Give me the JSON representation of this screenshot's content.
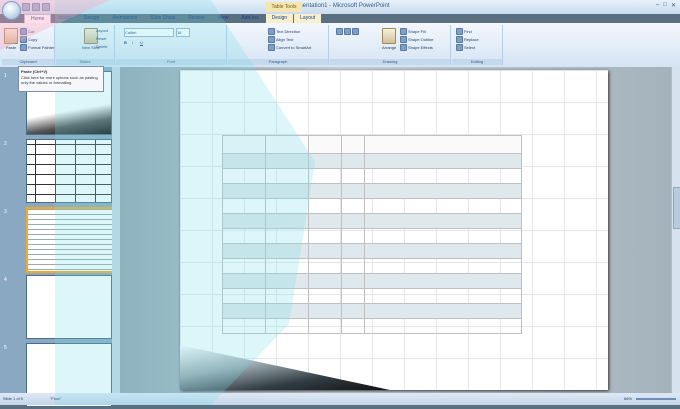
{
  "window": {
    "title": "Presentation1 - Microsoft PowerPoint",
    "context_tab_group": "Table Tools",
    "controls": [
      "–",
      "□",
      "✕"
    ]
  },
  "tabs": [
    "Home",
    "Insert",
    "Design",
    "Animations",
    "Slide Show",
    "Review",
    "View",
    "Add-Ins",
    "Design",
    "Layout"
  ],
  "active_tab": "Home",
  "ribbon": {
    "clipboard": {
      "label": "Clipboard",
      "paste": "Paste",
      "cut": "Cut",
      "copy": "Copy",
      "format_painter": "Format Painter"
    },
    "slides": {
      "label": "Slides",
      "new_slide": "New Slide",
      "layout": "Layout",
      "reset": "Reset",
      "delete": "Delete"
    },
    "font": {
      "label": "Font",
      "font_name": "Calibri",
      "font_size": "18"
    },
    "paragraph": {
      "label": "Paragraph",
      "text_direction": "Text Direction",
      "align_text": "Align Text",
      "convert_smartart": "Convert to SmartArt"
    },
    "drawing": {
      "label": "Drawing",
      "arrange": "Arrange",
      "quick_styles": "Quick Styles",
      "shape_fill": "Shape Fill",
      "shape_outline": "Shape Outline",
      "shape_effects": "Shape Effects"
    },
    "editing": {
      "label": "Editing",
      "find": "Find",
      "replace": "Replace",
      "select": "Select"
    }
  },
  "tooltip": {
    "title": "Paste (Ctrl+V)",
    "body": "Click here for more options such as pasting only the values or formatting."
  },
  "thumbnails": [
    {
      "number": "1"
    },
    {
      "number": "2"
    },
    {
      "number": "3"
    },
    {
      "number": "4"
    },
    {
      "number": "5"
    }
  ],
  "status": {
    "slide_info": "Slide 1 of 5",
    "theme": "\"Flow\"",
    "zoom": "66%"
  }
}
